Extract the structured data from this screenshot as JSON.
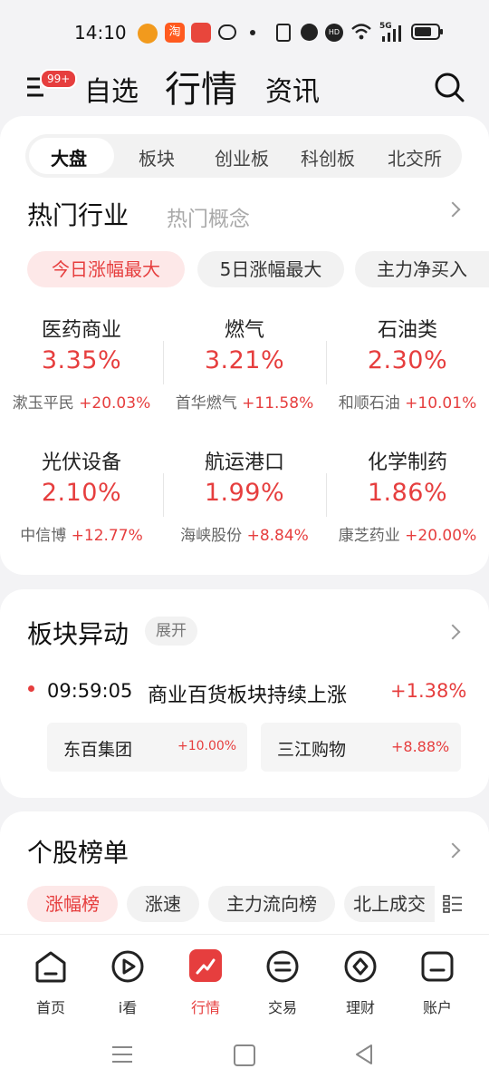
{
  "status_bar": {
    "time": "14:10",
    "network": "5G"
  },
  "header": {
    "badge": "99+",
    "tabs": [
      "自选",
      "行情",
      "资讯"
    ],
    "active_tab": "行情"
  },
  "market_tabs": [
    "大盘",
    "板块",
    "创业板",
    "科创板",
    "北交所"
  ],
  "hot_section": {
    "title": "热门行业",
    "alt_title": "热门概念",
    "filters": [
      "今日涨幅最大",
      "5日涨幅最大",
      "主力净买入"
    ],
    "tiles": [
      {
        "name": "医药商业",
        "pct": "3.35%",
        "stock": "漱玉平民",
        "stock_pct": "+20.03%"
      },
      {
        "name": "燃气",
        "pct": "3.21%",
        "stock": "首华燃气",
        "stock_pct": "+11.58%"
      },
      {
        "name": "石油类",
        "pct": "2.30%",
        "stock": "和顺石油",
        "stock_pct": "+10.01%"
      },
      {
        "name": "光伏设备",
        "pct": "2.10%",
        "stock": "中信博",
        "stock_pct": "+12.77%"
      },
      {
        "name": "航运港口",
        "pct": "1.99%",
        "stock": "海峡股份",
        "stock_pct": "+8.84%"
      },
      {
        "name": "化学制药",
        "pct": "1.86%",
        "stock": "康芝药业",
        "stock_pct": "+20.00%"
      }
    ]
  },
  "sector_alert": {
    "title": "板块异动",
    "expand_label": "展开",
    "time": "09:59:05",
    "headline": "商业百货板块持续上涨",
    "pct": "+1.38%",
    "stocks": [
      {
        "name": "东百集团",
        "pct": "+10.00%"
      },
      {
        "name": "三江购物",
        "pct": "+8.88%"
      }
    ]
  },
  "ranking": {
    "title": "个股榜单",
    "tabs": [
      "涨幅榜",
      "涨速",
      "主力流向榜",
      "北上成交"
    ]
  },
  "bottom_nav": [
    "首页",
    "i看",
    "行情",
    "交易",
    "理财",
    "账户"
  ],
  "colors": {
    "accent": "#e63e3e",
    "background": "#f3f3f5"
  }
}
